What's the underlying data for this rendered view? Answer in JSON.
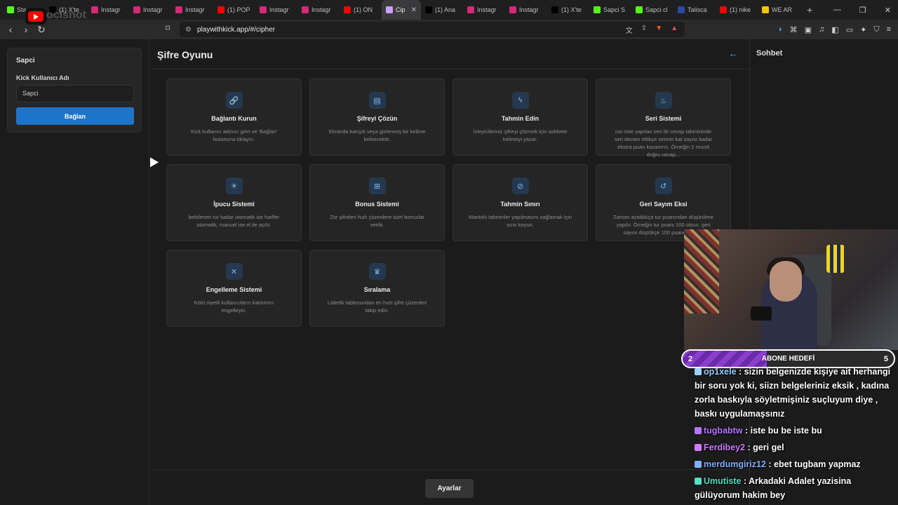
{
  "browser": {
    "tabs": [
      {
        "label": "Sta",
        "color": "#53fc18"
      },
      {
        "label": "(1) X'te",
        "color": "#000000"
      },
      {
        "label": "Instagr",
        "color": "#d62976"
      },
      {
        "label": "Instagr",
        "color": "#d62976"
      },
      {
        "label": "Instagr",
        "color": "#d62976"
      },
      {
        "label": "(1) POP",
        "color": "#ff0000"
      },
      {
        "label": "Instagr",
        "color": "#d62976"
      },
      {
        "label": "Instagr",
        "color": "#d62976"
      },
      {
        "label": "(1) ON",
        "color": "#ff0000"
      },
      {
        "label": "Cip",
        "color": "#c9a0ff",
        "active": true
      },
      {
        "label": "(1) Ana",
        "color": "#000000"
      },
      {
        "label": "Instagr",
        "color": "#d62976"
      },
      {
        "label": "Instagr",
        "color": "#d62976"
      },
      {
        "label": "(1) X'te",
        "color": "#000000"
      },
      {
        "label": "Sapci S",
        "color": "#53fc18"
      },
      {
        "label": "Sapci cl",
        "color": "#53fc18"
      },
      {
        "label": "Talisca",
        "color": "#2b4aa0"
      },
      {
        "label": "(1) nike",
        "color": "#ff0000"
      },
      {
        "label": "WE AR",
        "color": "#f5c400"
      }
    ],
    "new_tab": "+",
    "url": "playwithkick.app/#/cipher",
    "watermark": "ocisnot"
  },
  "left_panel": {
    "title": "Sapci",
    "username_label": "Kick Kullanıcı Adı",
    "username_value": "Sapci",
    "connect_button": "Bağlan"
  },
  "main": {
    "title": "Şifre Oyunu",
    "settings_button": "Ayarlar",
    "cards": [
      {
        "icon": "link-icon",
        "glyph": "🔗",
        "title": "Bağlantı Kurun",
        "desc": "Kick kullanıcı adınızı girin ve 'Bağlan' butonuna tıklayın."
      },
      {
        "icon": "chat-icon",
        "glyph": "▤",
        "title": "Şifreyi Çözün",
        "desc": "Ekranda karışık veya gizlenmiş bir kelime belirecektir."
      },
      {
        "icon": "lightning-icon",
        "glyph": "ϟ",
        "title": "Tahmin Edin",
        "desc": "İzleyicileriniz şifreyi çözmek için sohbete kelimeyi yazar."
      },
      {
        "icon": "flame-icon",
        "glyph": "♨",
        "title": "Seri Sistemi",
        "desc": "üst üste yapılan seri ile cevap tahmininde seri devam ettikçe serinin kat sayısı kadar ekstra puan kazanırın. Örneğin 2 round doğru cevap..."
      },
      {
        "icon": "lightbulb-icon",
        "glyph": "☀",
        "title": "İpucu Sistemi",
        "desc": "belirlenen tur kadar otomatik ise harfler otomatik, manuel ise el ile açılır."
      },
      {
        "icon": "gift-icon",
        "glyph": "⊞",
        "title": "Bonus Sistemi",
        "desc": "Zor şifreleri hızlı çözenlere özel bonuslar verilir."
      },
      {
        "icon": "ban-icon",
        "glyph": "⊘",
        "title": "Tahmin Sınırı",
        "desc": "Mantıklı tahminler yapılmasını sağlamak için sınır koyun."
      },
      {
        "icon": "history-icon",
        "glyph": "↺",
        "title": "Geri Sayım Eksi",
        "desc": "Zaman azaldıkça tur puanından düşürülme yapılır. Örneğin tur puanı 100 olsun, geri sayım düştükçe 100 puandan ek..."
      },
      {
        "icon": "user-block-icon",
        "glyph": "✕",
        "title": "Engelleme Sistemi",
        "desc": "Kötü niyetli kullanıcıların katılımını engelleyin."
      },
      {
        "icon": "trophy-icon",
        "glyph": "♛",
        "title": "Sıralama",
        "desc": "Liderlik tablosundan en hızlı şifre çözenleri takip edin."
      }
    ]
  },
  "right_panel": {
    "title": "Sohbet"
  },
  "stream_overlay": {
    "goal": {
      "label": "ABONE HEDEFİ",
      "current": "2",
      "target": "5",
      "progress": 0.4
    },
    "chat": [
      {
        "user": "op1xele",
        "color": "#9ad1ff",
        "text": " : sizin belgenizde kişiye ait herhangi bir soru yok ki, siizn belgeleriniz eksik , kadına zorla baskıyla söyletmişiniz suçluyum diye , baskı uygulamaşsınız"
      },
      {
        "user": "tugbabtw",
        "color": "#b278ff",
        "text": " : iste bu be iste bu"
      },
      {
        "user": "Ferdibey2",
        "color": "#d07bff",
        "text": " : geri gel"
      },
      {
        "user": "merdumgiriz12",
        "color": "#7fb0ff",
        "text": " : ebet tugbam yapmaz"
      },
      {
        "user": "Umutiste",
        "color": "#4fe3c1",
        "text": " : Arkadaki Adalet yazisina gülüyorum hakim bey"
      }
    ]
  }
}
